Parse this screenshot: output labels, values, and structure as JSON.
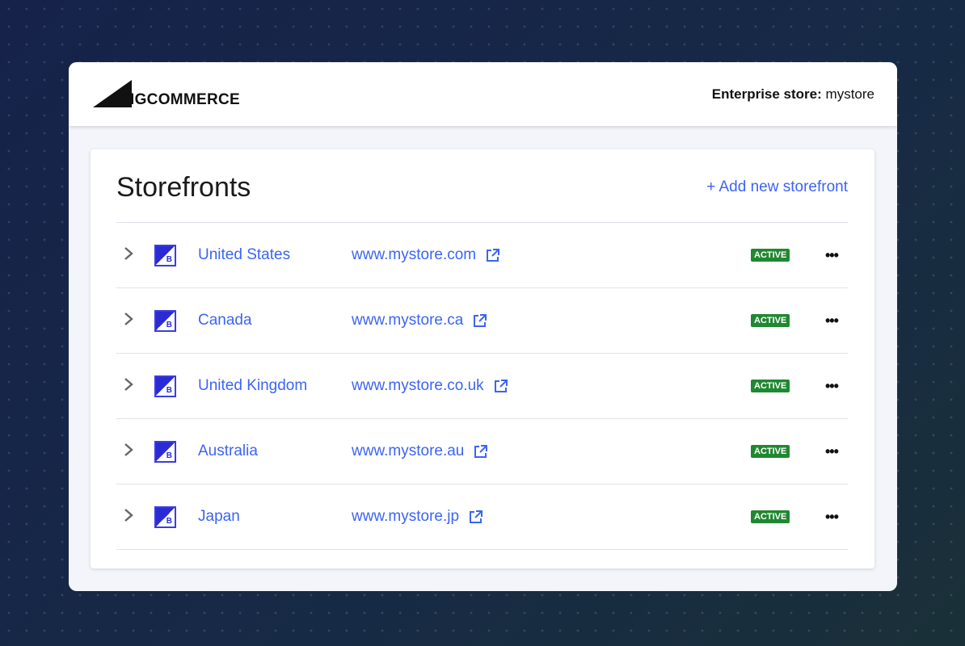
{
  "header": {
    "logo_text": "BIGCOMMERCE",
    "store_label": "Enterprise store:",
    "store_name": "mystore"
  },
  "page": {
    "title": "Storefronts",
    "add_label": "+ Add new storefront"
  },
  "storefronts": [
    {
      "name": "United States",
      "url": "www.mystore.com",
      "status": "ACTIVE"
    },
    {
      "name": "Canada",
      "url": "www.mystore.ca",
      "status": "ACTIVE"
    },
    {
      "name": "United Kingdom",
      "url": "www.mystore.co.uk",
      "status": "ACTIVE"
    },
    {
      "name": "Australia",
      "url": "www.mystore.au",
      "status": "ACTIVE"
    },
    {
      "name": "Japan",
      "url": "www.mystore.jp",
      "status": "ACTIVE"
    }
  ],
  "icons": {
    "row_icon": "B",
    "more": "•••",
    "chevron": "›"
  }
}
